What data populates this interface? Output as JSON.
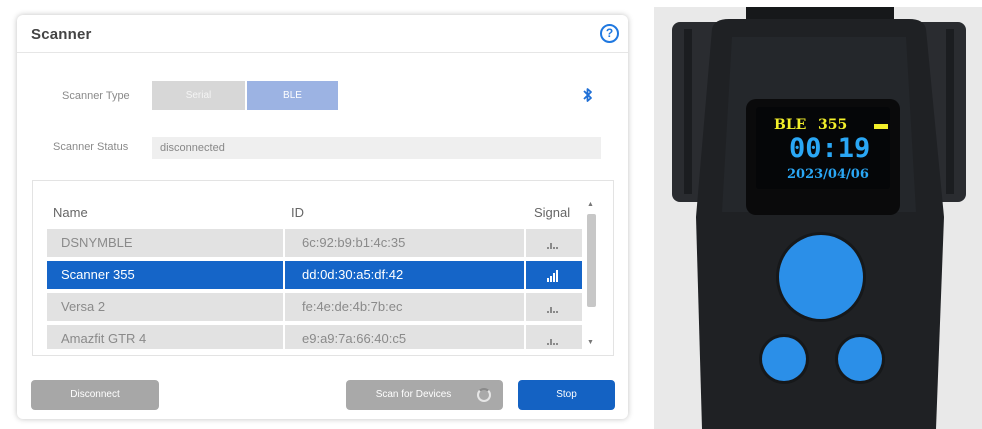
{
  "panel": {
    "title": "Scanner",
    "help_icon": "question-circle-icon"
  },
  "scanner_type": {
    "label": "Scanner Type",
    "options": [
      "Serial",
      "BLE"
    ],
    "selected": "BLE",
    "status_icon": "bluetooth-icon"
  },
  "scanner_status": {
    "label": "Scanner Status",
    "value": "disconnected"
  },
  "table": {
    "columns": [
      "Name",
      "ID",
      "Signal"
    ],
    "rows": [
      {
        "name": "DSNYMBLE",
        "id": "6c:92:b9:b1:4c:35",
        "signal_icon": "signal-weak-icon"
      },
      {
        "name": "Scanner 355",
        "id": "dd:0d:30:a5:df:42",
        "signal_icon": "signal-strong-icon",
        "selected": true
      },
      {
        "name": "Versa 2",
        "id": "fe:4e:de:4b:7b:ec",
        "signal_icon": "signal-weak-icon"
      },
      {
        "name": "Amazfit GTR 4",
        "id": "e9:a9:7a:66:40:c5",
        "signal_icon": "signal-weak-icon"
      }
    ]
  },
  "buttons": {
    "disconnect": "Disconnect",
    "scan": "Scan for Devices",
    "stop": "Stop"
  },
  "device_photo": {
    "screen_line1_left": "BLE",
    "screen_line1_right": "355",
    "screen_time": "00:19",
    "screen_date": "2023/04/06",
    "colors": {
      "housing": "#1f2124",
      "screen_text_yellow": "#f2ef2a",
      "screen_text_blue": "#2aa7f5",
      "buttons": "#2b8fe8"
    }
  }
}
